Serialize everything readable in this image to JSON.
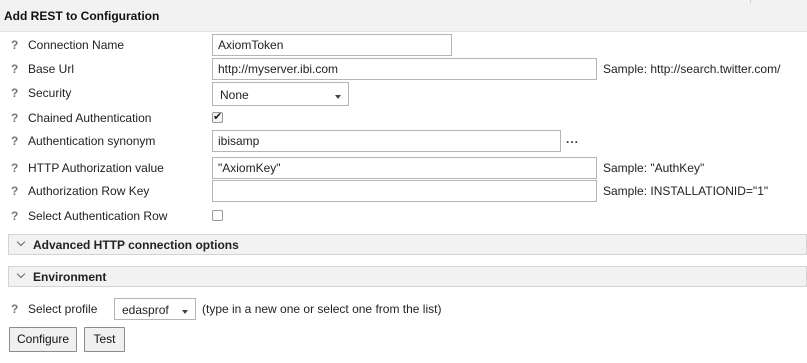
{
  "title": "Add REST to Configuration",
  "help_glyph": "?",
  "fields": {
    "connection_name": {
      "label": "Connection Name",
      "value": "AxiomToken"
    },
    "base_url": {
      "label": "Base Url",
      "value": "http://myserver.ibi.com",
      "sample": "Sample: http://search.twitter.com/"
    },
    "security": {
      "label": "Security",
      "value": "None"
    },
    "chained_auth": {
      "label": "Chained Authentication",
      "checked": true
    },
    "auth_synonym": {
      "label": "Authentication synonym",
      "value": "ibisamp",
      "browse": "..."
    },
    "http_auth_value": {
      "label": "HTTP Authorization value",
      "value": "\"AxiomKey\"",
      "sample": "Sample: \"AuthKey\""
    },
    "auth_row_key": {
      "label": "Authorization Row Key",
      "value": "",
      "sample": "Sample: INSTALLATIONID=\"1\""
    },
    "select_auth_row": {
      "label": "Select Authentication Row",
      "checked": false
    }
  },
  "sections": {
    "advanced": "Advanced HTTP connection options",
    "environment": "Environment"
  },
  "profile": {
    "label": "Select profile",
    "value": "edasprof",
    "hint": "(type in a new one or select one from the list)"
  },
  "buttons": {
    "configure": "Configure",
    "test": "Test"
  },
  "icons": {
    "checkmark": "✔"
  }
}
